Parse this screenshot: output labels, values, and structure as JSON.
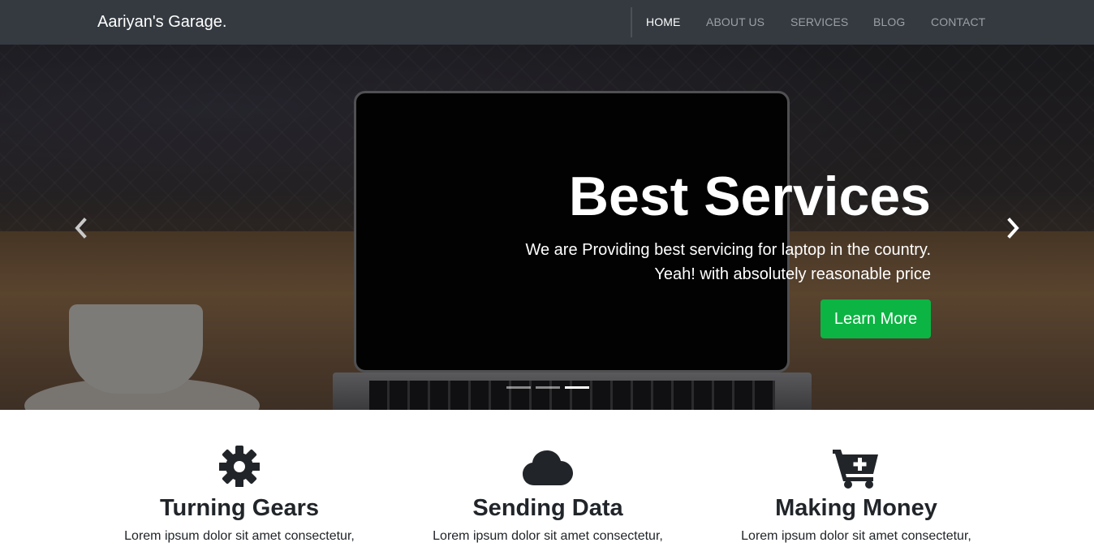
{
  "navbar": {
    "brand": "Aariyan's Garage.",
    "links": [
      {
        "label": "HOME",
        "active": true
      },
      {
        "label": "ABOUT US",
        "active": false
      },
      {
        "label": "SERVICES",
        "active": false
      },
      {
        "label": "BLOG",
        "active": false
      },
      {
        "label": "CONTACT",
        "active": false
      }
    ]
  },
  "hero": {
    "title": "Best Services",
    "line1": "We are Providing best servicing for laptop in the country.",
    "line2": "Yeah! with absolutely reasonable price",
    "button_label": "Learn More",
    "button_color": "#0cb443",
    "prev_icon": "chevron-left-icon",
    "next_icon": "chevron-right-icon",
    "slide_count": 3,
    "active_slide": 3
  },
  "features": [
    {
      "icon": "gear-icon",
      "title": "Turning Gears",
      "text": "Lorem ipsum dolor sit amet consectetur,"
    },
    {
      "icon": "cloud-icon",
      "title": "Sending Data",
      "text": "Lorem ipsum dolor sit amet consectetur,"
    },
    {
      "icon": "cart-plus-icon",
      "title": "Making Money",
      "text": "Lorem ipsum dolor sit amet consectetur,"
    }
  ]
}
